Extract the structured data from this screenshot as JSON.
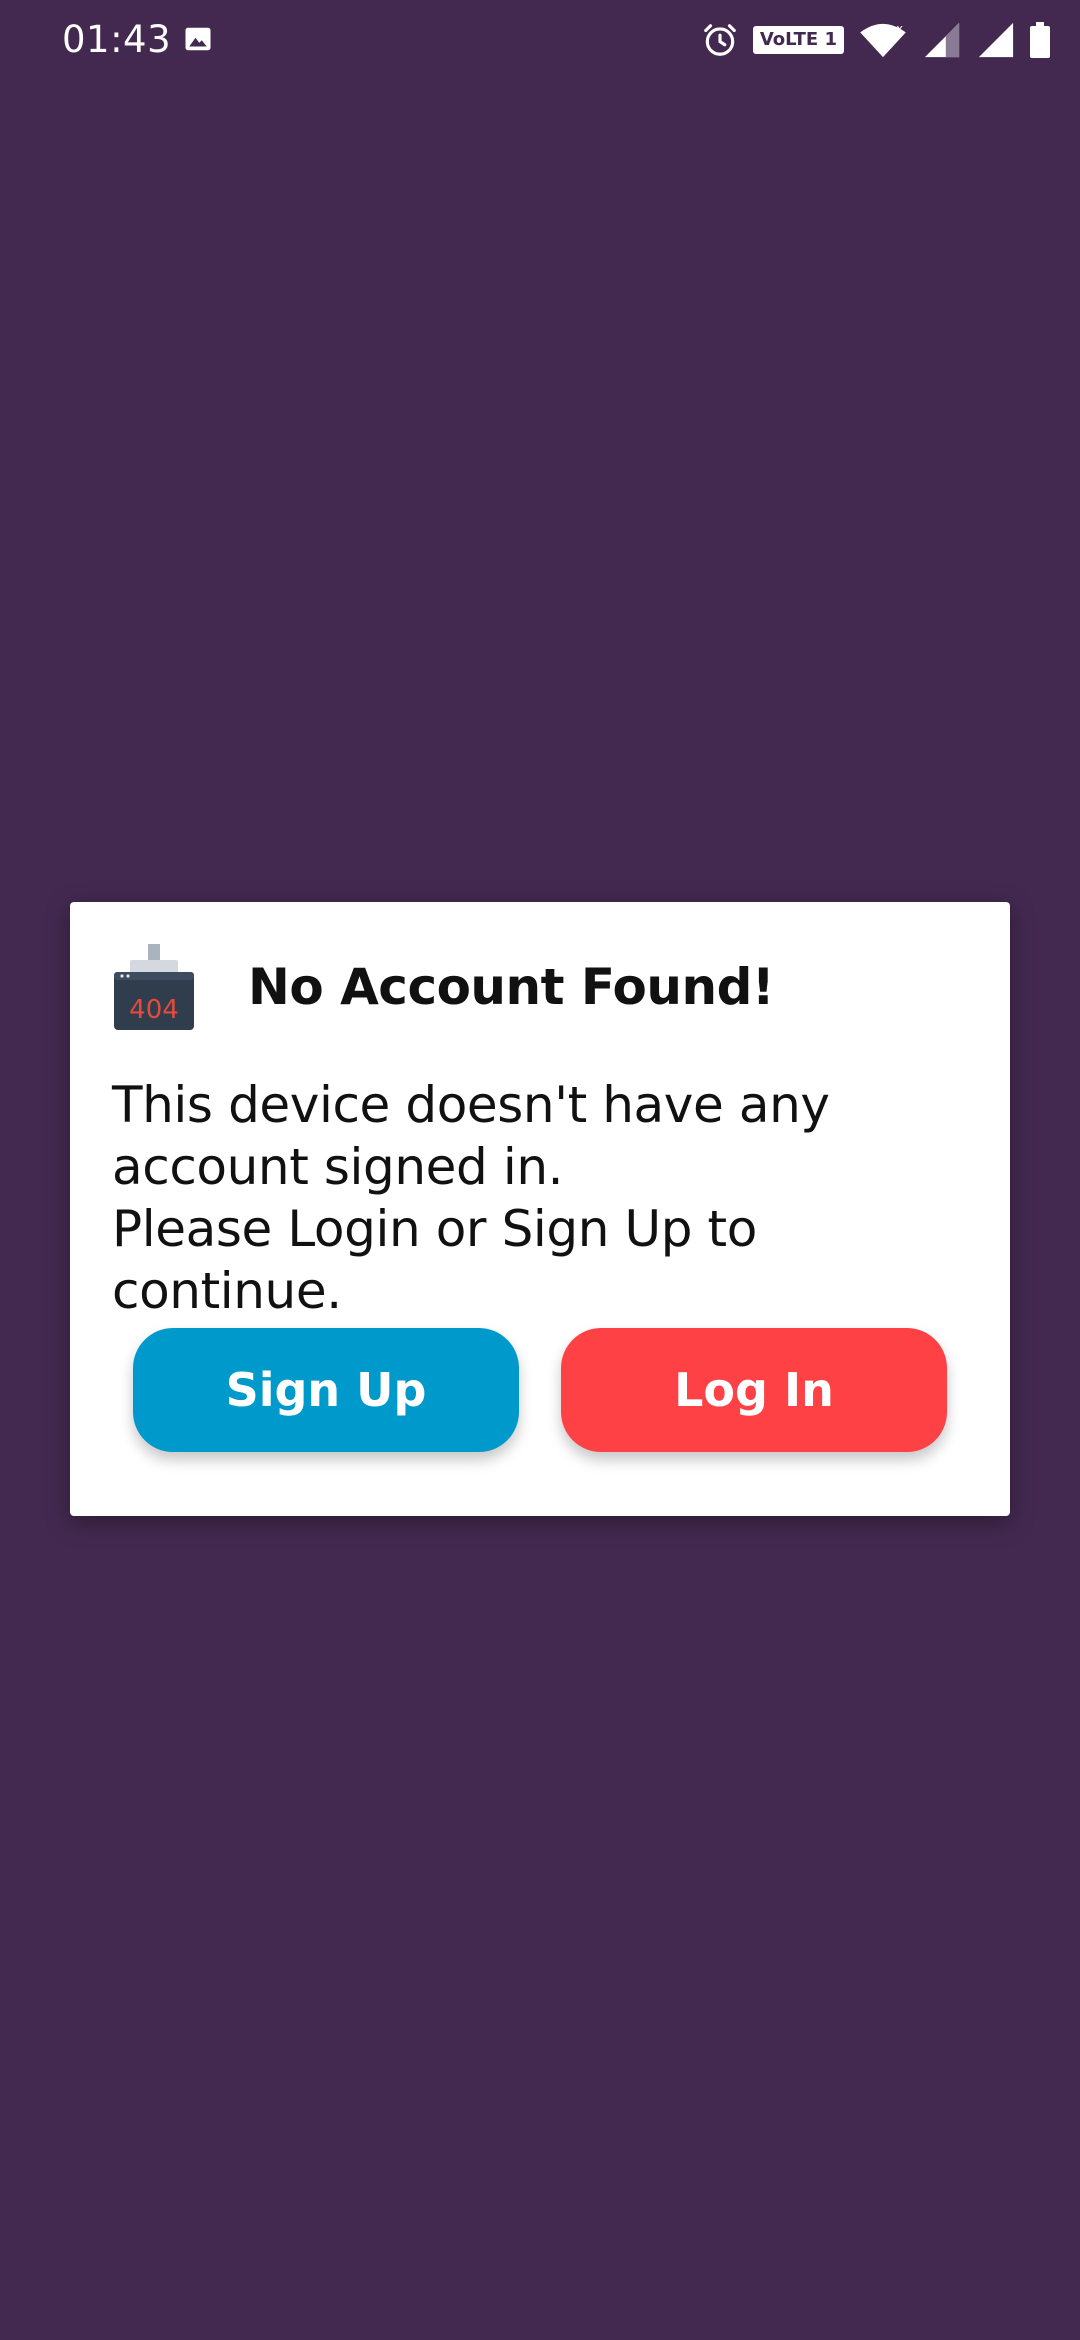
{
  "status_bar": {
    "time": "01:43",
    "network_badge": "VoLTE 1",
    "icons": [
      "image-icon",
      "alarm-icon",
      "wifi-icon",
      "signal-icon",
      "signal-icon",
      "battery-icon"
    ]
  },
  "dialog": {
    "title": "No Account Found!",
    "message": "This device doesn't have any\naccount signed in.\nPlease Login or Sign Up to continue.",
    "icon": "printer-404-icon",
    "icon_text": "404",
    "buttons": {
      "signup_label": "Sign Up",
      "login_label": "Log In"
    }
  },
  "colors": {
    "background": "#432950",
    "signup_button": "#0099cc",
    "login_button": "#fd4145",
    "dialog_background": "#ffffff"
  }
}
